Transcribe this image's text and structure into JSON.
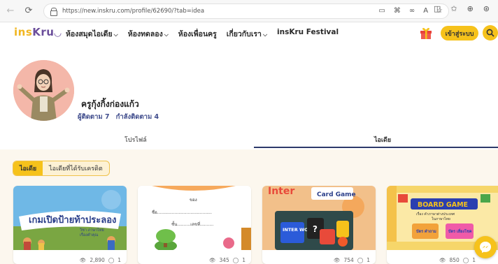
{
  "browser": {
    "url": "https://new.inskru.com/profile/62690/?tab=idea"
  },
  "header": {
    "logo_ins": "ins",
    "logo_kru": "Kru",
    "menu": [
      {
        "label": "ห้องสมุดไอเดีย",
        "chevron": true
      },
      {
        "label": "ห้องทดลอง",
        "chevron": true
      },
      {
        "label": "ห้องเพื่อนครู",
        "chevron": false
      },
      {
        "label": "เกี่ยวกับเรา",
        "chevron": true
      },
      {
        "label": "insKru Festival",
        "chevron": false
      }
    ],
    "login_label": "เข้าสู่ระบบ"
  },
  "profile": {
    "name": "ครูกุ้งกิ้งก่องแก้ว",
    "followers_label": "ผู้ติดตาม 7",
    "following_label": "กำลังติดตาม 4"
  },
  "tabs": [
    {
      "label": "โปรไฟล์",
      "active": false
    },
    {
      "label": "ไอเดีย",
      "active": true
    }
  ],
  "filters": [
    {
      "label": "ไอเดีย",
      "active": true
    },
    {
      "label": "ไอเดียที่ได้รับเครดิต",
      "active": false
    }
  ],
  "cards": [
    {
      "title": "เกมเปิดป้ายท้าประลอง",
      "subtitle1": "วิชา ภาษาไทย",
      "subtitle2": "เรื่องคำคุณ",
      "views": "2,890",
      "comments": "1"
    },
    {
      "title": "ของ",
      "line1": "ชื่อ.........................................",
      "line2": "ชั้น..........เลขที่..........",
      "views": "345",
      "comments": "1"
    },
    {
      "title": "Card Game",
      "words": "INTER WORD",
      "views": "754",
      "comments": "1"
    },
    {
      "title": "BOARD GAME",
      "sub1": "เรื่อง คำภาษาต่างประเทศ",
      "sub2": "ในภาษาไทย",
      "btn1": "บัตร คำถาม",
      "btn2": "บัตร เสี่ยงโชค",
      "views": "850",
      "comments": "1"
    }
  ],
  "colors": {
    "accent": "#f6c21b",
    "brand_purple": "#6b4e9b",
    "nav_blue": "#2d3a6b"
  }
}
